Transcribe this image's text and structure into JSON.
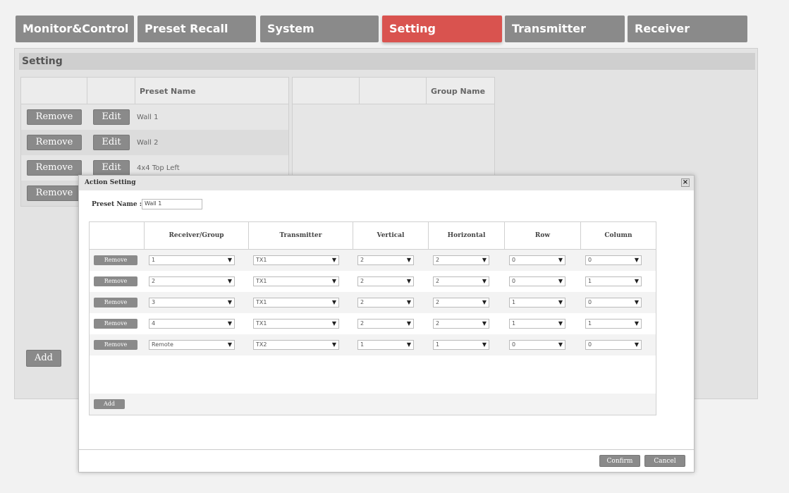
{
  "tabs": [
    {
      "label": "Monitor&Control",
      "active": false
    },
    {
      "label": "Preset Recall",
      "active": false
    },
    {
      "label": "System",
      "active": false
    },
    {
      "label": "Setting",
      "active": true
    },
    {
      "label": "Transmitter",
      "active": false
    },
    {
      "label": "Receiver",
      "active": false
    }
  ],
  "colors": {
    "tab": "#8a8a8a",
    "tab_active": "#d9534f"
  },
  "setting": {
    "title": "Setting",
    "preset_table": {
      "header": "Preset Name",
      "remove_label": "Remove",
      "edit_label": "Edit",
      "rows": [
        "Wall 1",
        "Wall 2",
        "4x4 Top Left",
        ""
      ],
      "add_label": "Add"
    },
    "group_table": {
      "header": "Group Name"
    }
  },
  "modal": {
    "title": "Action Setting",
    "close_icon": "close-icon",
    "preset_name_label": "Preset Name :",
    "preset_name_value": "Wall 1",
    "columns": [
      "",
      "Receiver/Group",
      "Transmitter",
      "Vertical",
      "Horizontal",
      "Row",
      "Column"
    ],
    "remove_label": "Remove",
    "rows": [
      {
        "receiver": "1",
        "transmitter": "TX1",
        "vertical": "2",
        "horizontal": "2",
        "row": "0",
        "column": "0"
      },
      {
        "receiver": "2",
        "transmitter": "TX1",
        "vertical": "2",
        "horizontal": "2",
        "row": "0",
        "column": "1"
      },
      {
        "receiver": "3",
        "transmitter": "TX1",
        "vertical": "2",
        "horizontal": "2",
        "row": "1",
        "column": "0"
      },
      {
        "receiver": "4",
        "transmitter": "TX1",
        "vertical": "2",
        "horizontal": "2",
        "row": "1",
        "column": "1"
      },
      {
        "receiver": "Remote",
        "transmitter": "TX2",
        "vertical": "1",
        "horizontal": "1",
        "row": "0",
        "column": "0"
      }
    ],
    "add_label": "Add",
    "confirm_label": "Confirm",
    "cancel_label": "Cancel"
  }
}
